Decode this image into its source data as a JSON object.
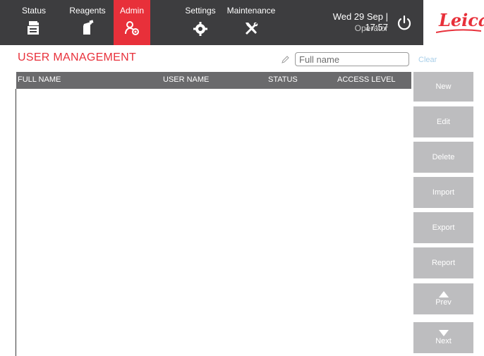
{
  "nav": {
    "tabs": [
      {
        "label": "Status",
        "icon": "printer-icon"
      },
      {
        "label": "Reagents",
        "icon": "reagent-bottle-icon"
      },
      {
        "label": "Admin",
        "icon": "admin-users-gear-icon",
        "active": true
      },
      {
        "label": "Settings",
        "icon": "gear-icon"
      },
      {
        "label": "Maintenance",
        "icon": "tools-icon"
      }
    ],
    "datetime": "Wed 29 Sep | 17:57",
    "user_role": "Operator",
    "power_icon": "power-icon",
    "logo": "Leica"
  },
  "page": {
    "title": "USER MANAGEMENT",
    "search": {
      "placeholder": "Full name",
      "value": ""
    },
    "clear_label": "Clear"
  },
  "table": {
    "columns": [
      "FULL NAME",
      "USER NAME",
      "STATUS",
      "ACCESS LEVEL"
    ],
    "rows": []
  },
  "actions": {
    "new": "New",
    "edit": "Edit",
    "delete": "Delete",
    "import": "Import",
    "export": "Export",
    "report": "Report",
    "prev": "Prev",
    "next": "Next"
  },
  "colors": {
    "topbar": "#3d3d3f",
    "accent": "#e8303a",
    "button": "#bdbdbf",
    "table_header": "#6a6a6c",
    "link": "#a9cfe9"
  }
}
